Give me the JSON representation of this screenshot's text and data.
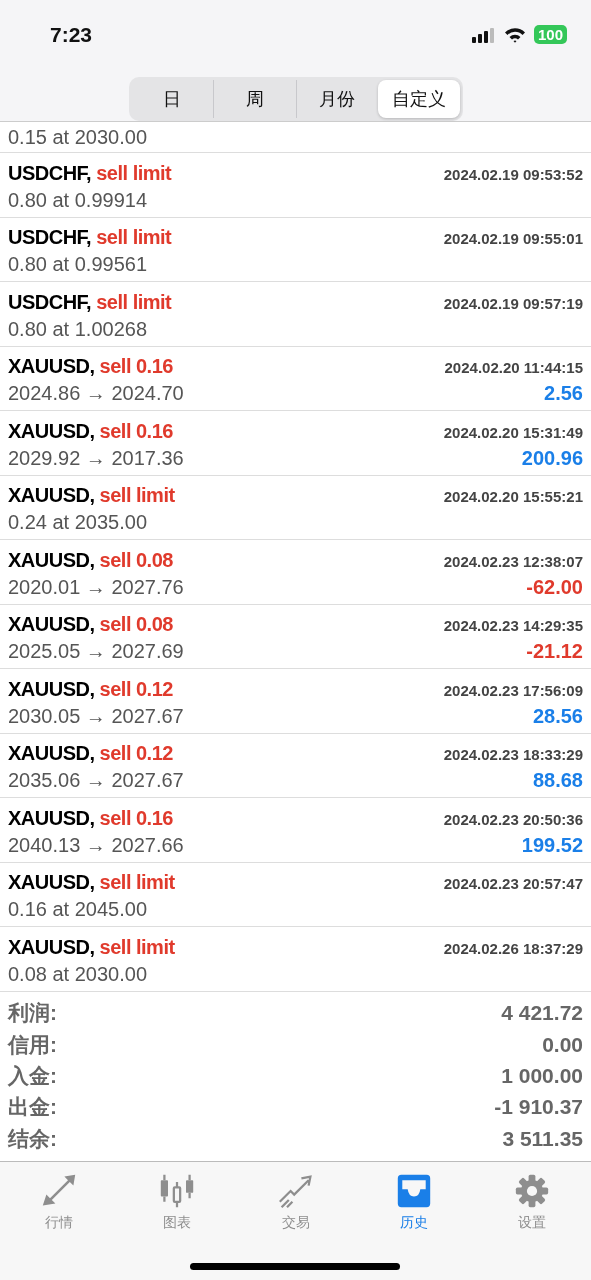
{
  "status_bar": {
    "time": "7:23",
    "battery": "100"
  },
  "period_tabs": [
    {
      "label": "日",
      "selected": false
    },
    {
      "label": "周",
      "selected": false
    },
    {
      "label": "月份",
      "selected": false
    },
    {
      "label": "自定义",
      "selected": true
    }
  ],
  "partial_row": {
    "detail": "0.15 at 2030.00"
  },
  "rows": [
    {
      "kind": "order",
      "symbol": "USDCHF,",
      "action": "sell limit",
      "time": "2024.02.19 09:53:52",
      "detail": "0.80 at 0.99914"
    },
    {
      "kind": "order",
      "symbol": "USDCHF,",
      "action": "sell limit",
      "time": "2024.02.19 09:55:01",
      "detail": "0.80 at 0.99561"
    },
    {
      "kind": "order",
      "symbol": "USDCHF,",
      "action": "sell limit",
      "time": "2024.02.19 09:57:19",
      "detail": "0.80 at 1.00268"
    },
    {
      "kind": "deal",
      "symbol": "XAUUSD,",
      "action": "sell 0.16",
      "time": "2024.02.20 11:44:15",
      "detail": "2024.86 → 2024.70",
      "profit": "2.56",
      "negative": false
    },
    {
      "kind": "deal",
      "symbol": "XAUUSD,",
      "action": "sell 0.16",
      "time": "2024.02.20 15:31:49",
      "detail": "2029.92 → 2017.36",
      "profit": "200.96",
      "negative": false
    },
    {
      "kind": "order",
      "symbol": "XAUUSD,",
      "action": "sell limit",
      "time": "2024.02.20 15:55:21",
      "detail": "0.24 at 2035.00"
    },
    {
      "kind": "deal",
      "symbol": "XAUUSD,",
      "action": "sell 0.08",
      "time": "2024.02.23 12:38:07",
      "detail": "2020.01 → 2027.76",
      "profit": "-62.00",
      "negative": true
    },
    {
      "kind": "deal",
      "symbol": "XAUUSD,",
      "action": "sell 0.08",
      "time": "2024.02.23 14:29:35",
      "detail": "2025.05 → 2027.69",
      "profit": "-21.12",
      "negative": true
    },
    {
      "kind": "deal",
      "symbol": "XAUUSD,",
      "action": "sell 0.12",
      "time": "2024.02.23 17:56:09",
      "detail": "2030.05 → 2027.67",
      "profit": "28.56",
      "negative": false
    },
    {
      "kind": "deal",
      "symbol": "XAUUSD,",
      "action": "sell 0.12",
      "time": "2024.02.23 18:33:29",
      "detail": "2035.06 → 2027.67",
      "profit": "88.68",
      "negative": false
    },
    {
      "kind": "deal",
      "symbol": "XAUUSD,",
      "action": "sell 0.16",
      "time": "2024.02.23 20:50:36",
      "detail": "2040.13 → 2027.66",
      "profit": "199.52",
      "negative": false
    },
    {
      "kind": "order",
      "symbol": "XAUUSD,",
      "action": "sell limit",
      "time": "2024.02.23 20:57:47",
      "detail": "0.16 at 2045.00"
    },
    {
      "kind": "order",
      "symbol": "XAUUSD,",
      "action": "sell limit",
      "time": "2024.02.26 18:37:29",
      "detail": "0.08 at 2030.00"
    }
  ],
  "summary": [
    {
      "label": "利润:",
      "value": "4 421.72"
    },
    {
      "label": "信用:",
      "value": "0.00"
    },
    {
      "label": "入金:",
      "value": "1 000.00"
    },
    {
      "label": "出金:",
      "value": "-1 910.37"
    },
    {
      "label": "结余:",
      "value": "3 511.35"
    }
  ],
  "tab_bar": [
    {
      "kind": "quotes",
      "label": "行情",
      "selected": false
    },
    {
      "kind": "chart",
      "label": "图表",
      "selected": false
    },
    {
      "kind": "trade",
      "label": "交易",
      "selected": false
    },
    {
      "kind": "history",
      "label": "历史",
      "selected": true
    },
    {
      "kind": "settings",
      "label": "设置",
      "selected": false
    }
  ]
}
